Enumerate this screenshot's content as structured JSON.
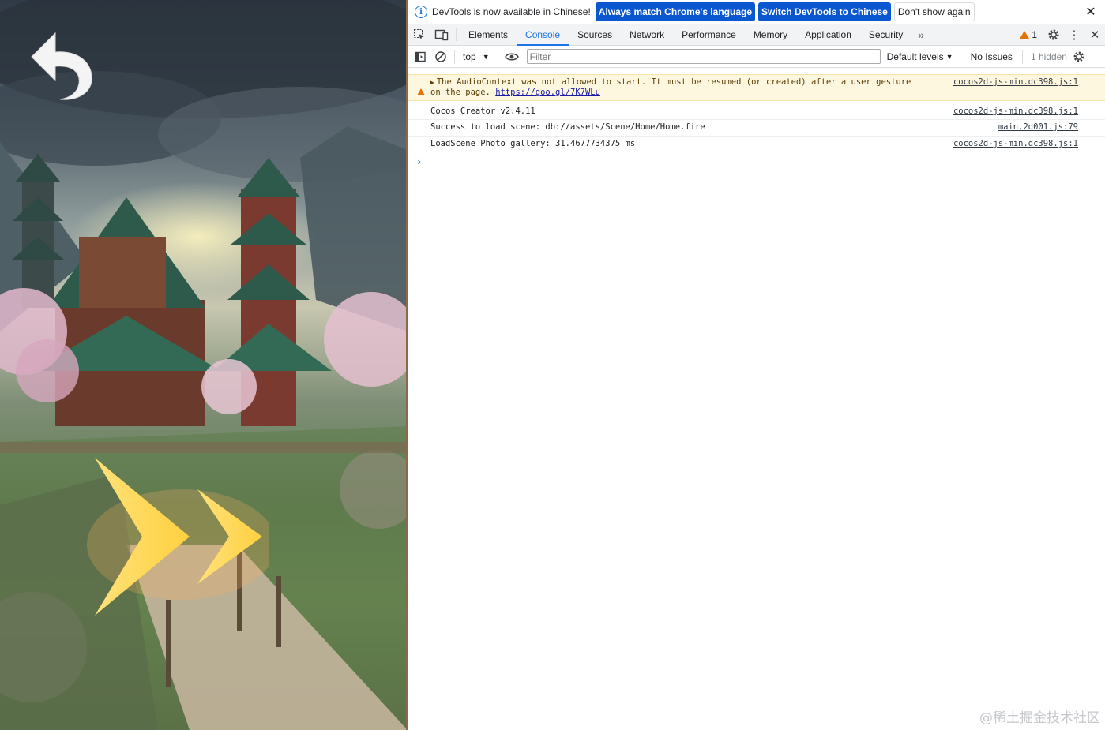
{
  "infobar": {
    "message": "DevTools is now available in Chinese!",
    "btn_match": "Always match Chrome's language",
    "btn_switch": "Switch DevTools to Chinese",
    "btn_dismiss": "Don't show again",
    "close_glyph": "✕"
  },
  "tabs": [
    {
      "label": "Elements",
      "active": false
    },
    {
      "label": "Console",
      "active": true
    },
    {
      "label": "Sources",
      "active": false
    },
    {
      "label": "Network",
      "active": false
    },
    {
      "label": "Performance",
      "active": false
    },
    {
      "label": "Memory",
      "active": false
    },
    {
      "label": "Application",
      "active": false
    },
    {
      "label": "Security",
      "active": false
    }
  ],
  "tabbar": {
    "more_glyph": "»",
    "warning_count": "1",
    "menu_glyph": "⋮",
    "close_glyph": "✕"
  },
  "toolbar": {
    "context": "top",
    "filter_placeholder": "Filter",
    "levels": "Default levels",
    "issues": "No Issues",
    "hidden": "1 hidden"
  },
  "console": {
    "messages": [
      {
        "level": "warning",
        "text": "The AudioContext was not allowed to start. It must be resumed (or created) after a user gesture",
        "text2": "on the page. ",
        "link": "https://goo.gl/7K7WLu",
        "source": "cocos2d-js-min.dc398.js:1"
      },
      {
        "level": "info",
        "text": "Cocos Creator v2.4.11",
        "source": "cocos2d-js-min.dc398.js:1"
      },
      {
        "level": "info",
        "text": "Success to load scene: db://assets/Scene/Home/Home.fire",
        "source": "main.2d001.js:79"
      },
      {
        "level": "info",
        "text": "LoadScene Photo_gallery: 31.4677734375 ms",
        "source": "cocos2d-js-min.dc398.js:1"
      }
    ],
    "prompt_glyph": "›"
  },
  "watermark": "@稀土掘金技术社区",
  "game": {
    "back_icon": "undo-arrow-icon",
    "next_icon": "double-chevron-right-icon"
  },
  "colors": {
    "accent": "#1a73e8",
    "primary_button": "#0b57d0",
    "warning_bg": "#fef7e0",
    "warning_icon": "#e37400"
  }
}
